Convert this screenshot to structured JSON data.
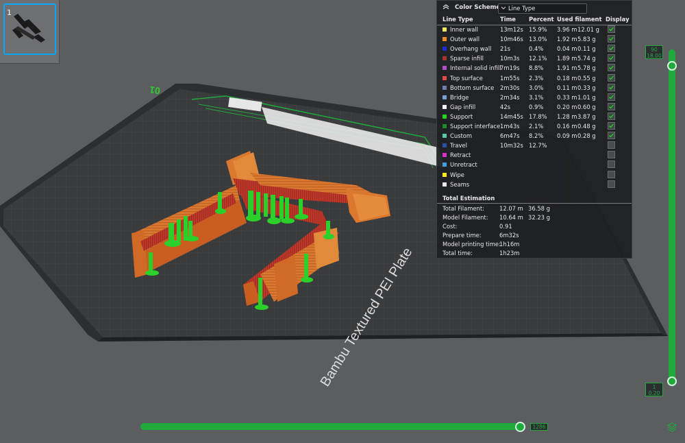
{
  "thumbnail": {
    "number": "1"
  },
  "plate": {
    "name": "Bambu Textured PEI Plate",
    "number_label": "01"
  },
  "legend": {
    "title": "Color Scheme",
    "scheme": "Line Type",
    "columns": {
      "line_type": "Line Type",
      "time": "Time",
      "percent": "Percent",
      "filament": "Used filament",
      "display": "Display"
    },
    "rows": [
      {
        "name": "Inner wall",
        "color": "#f5e56b",
        "time": "13m12s",
        "percent": "15.9%",
        "meters": "3.96 m",
        "grams": "12.01 g",
        "display": true
      },
      {
        "name": "Outer wall",
        "color": "#f08a2c",
        "time": "10m46s",
        "percent": "13.0%",
        "meters": "1.92 m",
        "grams": "5.83 g",
        "display": true
      },
      {
        "name": "Overhang wall",
        "color": "#1f2ad8",
        "time": "21s",
        "percent": "0.4%",
        "meters": "0.04 m",
        "grams": "0.11 g",
        "display": true
      },
      {
        "name": "Sparse infill",
        "color": "#a8342f",
        "time": "10m3s",
        "percent": "12.1%",
        "meters": "1.89 m",
        "grams": "5.74 g",
        "display": true
      },
      {
        "name": "Internal solid infill",
        "color": "#b04fc6",
        "time": "7m19s",
        "percent": "8.8%",
        "meters": "1.91 m",
        "grams": "5.78 g",
        "display": true
      },
      {
        "name": "Top surface",
        "color": "#e04a4a",
        "time": "1m55s",
        "percent": "2.3%",
        "meters": "0.18 m",
        "grams": "0.55 g",
        "display": true
      },
      {
        "name": "Bottom surface",
        "color": "#6e7fb0",
        "time": "2m30s",
        "percent": "3.0%",
        "meters": "0.11 m",
        "grams": "0.33 g",
        "display": true
      },
      {
        "name": "Bridge",
        "color": "#7aa0d0",
        "time": "2m34s",
        "percent": "3.1%",
        "meters": "0.33 m",
        "grams": "1.01 g",
        "display": true
      },
      {
        "name": "Gap infill",
        "color": "#f2f2f2",
        "time": "42s",
        "percent": "0.9%",
        "meters": "0.20 m",
        "grams": "0.60 g",
        "display": true
      },
      {
        "name": "Support",
        "color": "#22d81f",
        "time": "14m45s",
        "percent": "17.8%",
        "meters": "1.28 m",
        "grams": "3.87 g",
        "display": true
      },
      {
        "name": "Support interface",
        "color": "#1f8a2a",
        "time": "1m43s",
        "percent": "2.1%",
        "meters": "0.16 m",
        "grams": "0.48 g",
        "display": true
      },
      {
        "name": "Custom",
        "color": "#5ac8a6",
        "time": "6m47s",
        "percent": "8.2%",
        "meters": "0.09 m",
        "grams": "0.28 g",
        "display": true
      },
      {
        "name": "Travel",
        "color": "#2d4fa8",
        "time": "10m32s",
        "percent": "12.7%",
        "meters": "",
        "grams": "",
        "display": false
      },
      {
        "name": "Retract",
        "color": "#d632c8",
        "time": "",
        "percent": "",
        "meters": "",
        "grams": "",
        "display": false
      },
      {
        "name": "Unretract",
        "color": "#3fa0d8",
        "time": "",
        "percent": "",
        "meters": "",
        "grams": "",
        "display": false
      },
      {
        "name": "Wipe",
        "color": "#f7e81f",
        "time": "",
        "percent": "",
        "meters": "",
        "grams": "",
        "display": false
      },
      {
        "name": "Seams",
        "color": "#e8e8e8",
        "time": "",
        "percent": "",
        "meters": "",
        "grams": "",
        "display": false
      }
    ],
    "total_title": "Total Estimation",
    "totals": [
      {
        "label": "Total Filament:",
        "v1": "12.07 m",
        "v2": "36.58 g"
      },
      {
        "label": "Model Filament:",
        "v1": "10.64 m",
        "v2": "32.23 g"
      },
      {
        "label": "Cost:",
        "v1": "0.91",
        "v2": ""
      },
      {
        "label": "Prepare time:",
        "v1": "6m32s",
        "v2": ""
      },
      {
        "label": "Model printing time:",
        "v1": "1h16m",
        "v2": ""
      },
      {
        "label": "Total time:",
        "v1": "1h23m",
        "v2": ""
      }
    ]
  },
  "layer_slider": {
    "top_layer": "90",
    "top_height": "18.00",
    "bottom_layer": "1",
    "bottom_height": "0.20"
  },
  "move_slider": {
    "value": "1286"
  },
  "colors": {
    "accent": "#1faa3b",
    "orange": "#d9782e",
    "red": "#c0392b",
    "green_support": "#2bd02a"
  }
}
